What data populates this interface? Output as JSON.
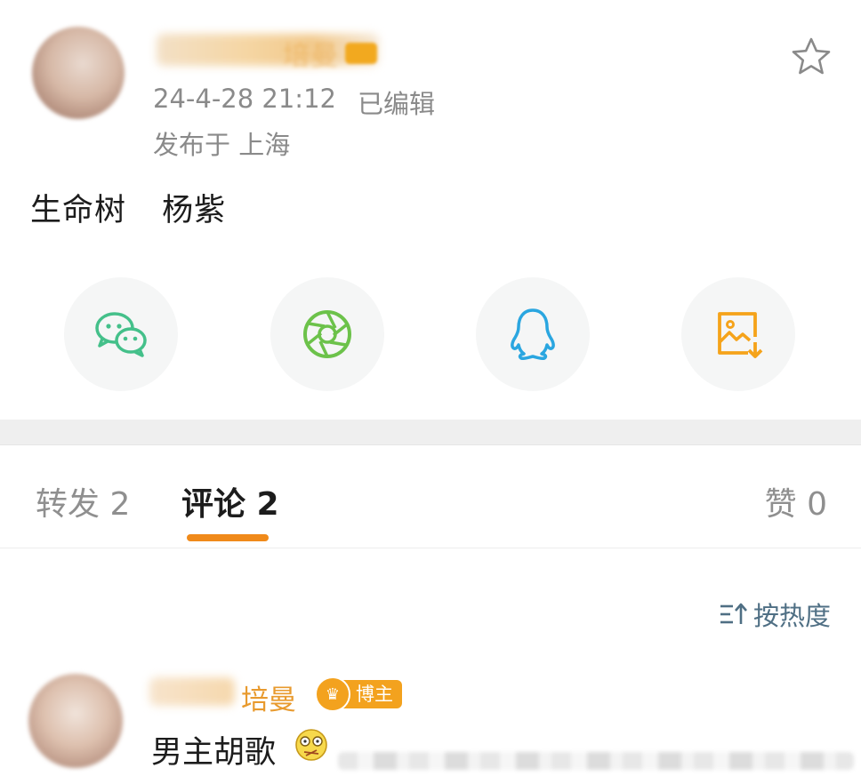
{
  "post": {
    "author_partial": "培曼",
    "timestamp": "24-4-28 21:12",
    "edited_label": "已编辑",
    "location": "发布于 上海",
    "content_words": [
      "生命树",
      "杨紫"
    ]
  },
  "share": {
    "items": [
      {
        "name": "wechat",
        "icon": "wechat-icon",
        "color": "#44c08a"
      },
      {
        "name": "moments",
        "icon": "aperture-icon",
        "color": "#6cc24a"
      },
      {
        "name": "qq",
        "icon": "qq-penguin-icon",
        "color": "#2aa6e0"
      },
      {
        "name": "save-image",
        "icon": "image-download-icon",
        "color": "#f5a31a"
      }
    ]
  },
  "tabs": {
    "repost": "转发 2",
    "comments": "评论 2",
    "likes": "赞 0",
    "active": "comments",
    "accent_color": "#f08a1a"
  },
  "sort": {
    "label": "按热度",
    "icon": "sort-icon"
  },
  "comment": {
    "author_partial": "　培曼",
    "badge_label": "博主",
    "text": "男主胡歌",
    "emoji": "dizzy-emoji-icon"
  }
}
